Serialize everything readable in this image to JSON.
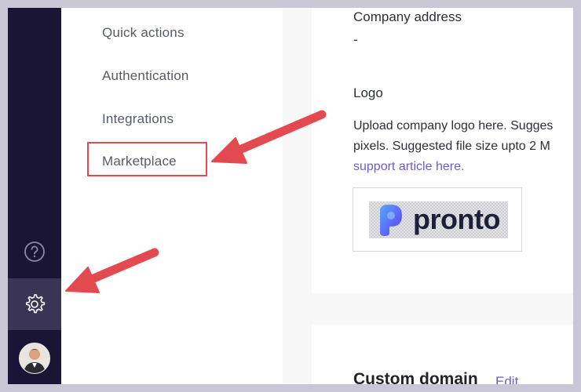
{
  "sidebar": {
    "icons": [
      "help-icon",
      "settings-icon",
      "user-avatar"
    ]
  },
  "settings_menu": {
    "items": [
      {
        "label": "Quick actions"
      },
      {
        "label": "Authentication"
      },
      {
        "label": "Integrations"
      },
      {
        "label": "Marketplace"
      }
    ]
  },
  "company": {
    "address_label": "Company address",
    "address_value": "-",
    "logo_label": "Logo",
    "logo_desc_line1": "Upload company logo here. Sugges",
    "logo_desc_line2": "pixels. Suggested file size upto 2 M",
    "logo_link": "support article here.",
    "logo_brand_text": "pronto"
  },
  "custom_domain": {
    "title": "Custom domain",
    "edit_label": "Edit"
  },
  "annotations": {
    "highlight_color": "#e24a4f"
  }
}
